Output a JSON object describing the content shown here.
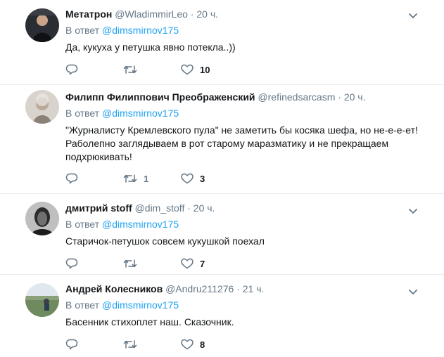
{
  "reply_prefix": "В ответ",
  "tweets": [
    {
      "name": "Метатрон",
      "handle": "@WladimmirLeo",
      "dot": "·",
      "time": "20 ч.",
      "reply_mention": "@dimsmirnov175",
      "text": "Да, кукуха у петушка явно потекла..))",
      "reply_count": "",
      "retweet_count": "",
      "like_count": "10"
    },
    {
      "name": "Филипп Филиппович Преображенский",
      "handle": "@refinedsarcasm",
      "dot": "·",
      "time": "20 ч.",
      "reply_mention": "@dimsmirnov175",
      "text": "\"Журналисту Кремлевского пула\" не заметить бы косяка шефа, но не-е-е-ет! Раболепно заглядываем в рот старому маразматику и не прекращаем подхрюкивать!",
      "reply_count": "",
      "retweet_count": "1",
      "like_count": "3"
    },
    {
      "name": "дмитрий stoff",
      "handle": "@dim_stoff",
      "dot": "·",
      "time": "20 ч.",
      "reply_mention": "@dimsmirnov175",
      "text": "Старичок-петушок совсем кукушкой поехал",
      "reply_count": "",
      "retweet_count": "",
      "like_count": "7"
    },
    {
      "name": "Андрей Колесников",
      "handle": "@Andru211276",
      "dot": "·",
      "time": "21 ч.",
      "reply_mention": "@dimsmirnov175",
      "text": "Басенник стихоплет наш. Сказочник.",
      "reply_count": "",
      "retweet_count": "",
      "like_count": "8"
    }
  ],
  "colors": {
    "link": "#1da1f2",
    "secondary": "#657786",
    "primary": "#14171a",
    "divider": "#e6ecf0"
  },
  "icons": [
    "reply-icon",
    "retweet-icon",
    "like-icon",
    "chevron-down-icon"
  ]
}
